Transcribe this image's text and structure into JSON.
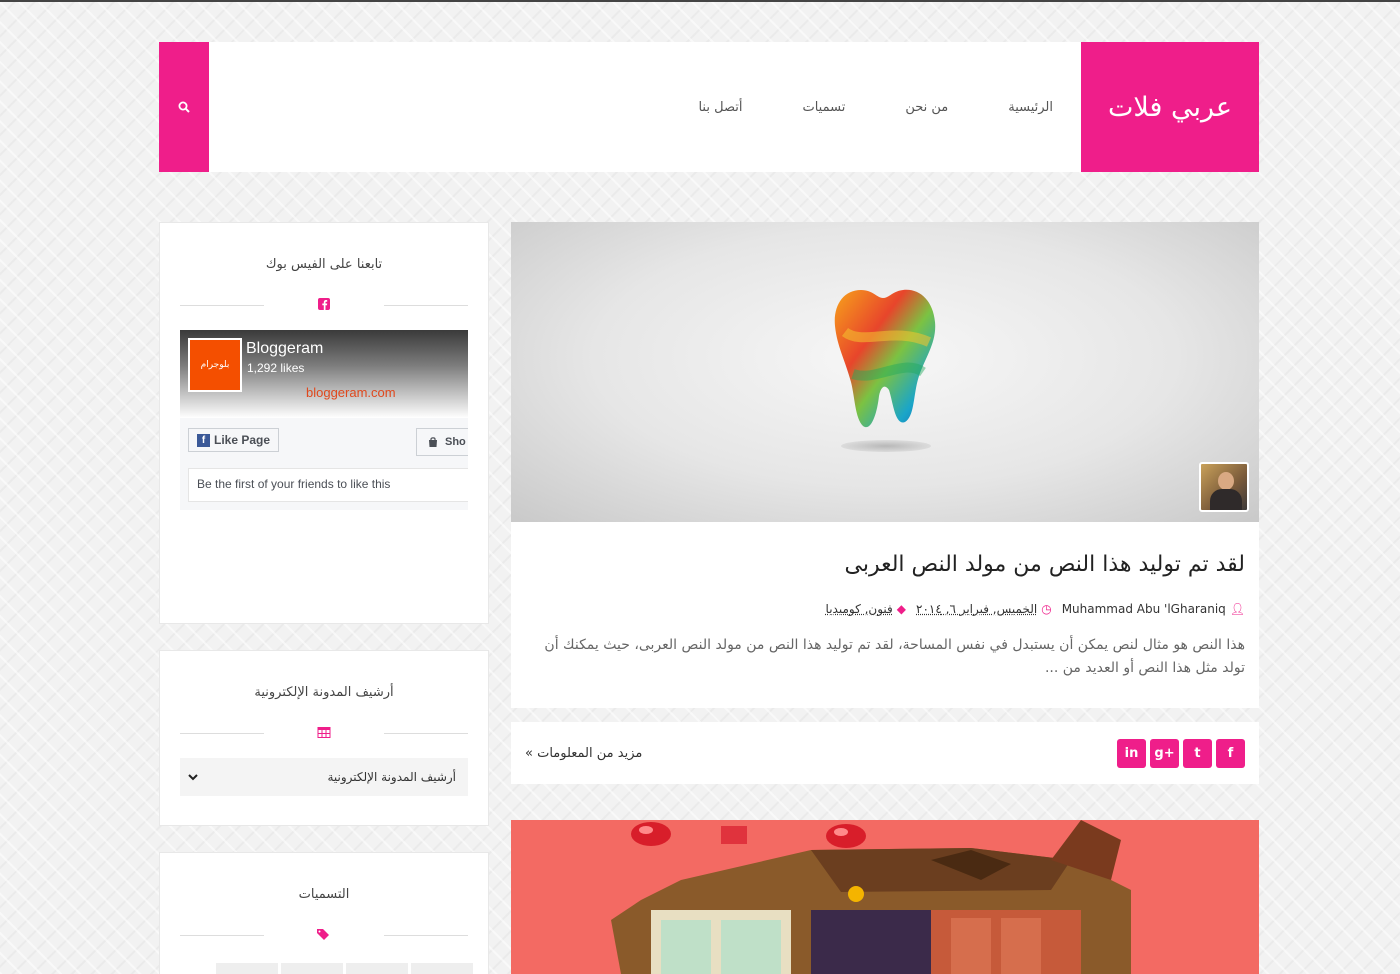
{
  "header": {
    "brand": "عربي فلات",
    "nav": [
      "الرئيسية",
      "من نحن",
      "تسميات",
      "أتصل بنا"
    ],
    "search_icon": "search-icon"
  },
  "post": {
    "title": "لقد تم توليد هذا النص من مولد النص العربى",
    "author": "Muhammad Abu 'lGharaniq",
    "date": "الخميس, فبراير ٦, ٢٠١٤",
    "labels": "فنون, كوميديا",
    "excerpt": "هذا النص هو مثال لنص يمكن أن يستبدل في نفس المساحة، لقد تم توليد هذا النص من مولد النص العربى، حيث يمكنك أن تولد مثل هذا النص أو العديد من ...",
    "more_link": "مزيد من المعلومات »",
    "social": [
      "f",
      "t",
      "g+",
      "in"
    ]
  },
  "sidebar": {
    "facebook": {
      "title": "تابعنا على الفيس بوك",
      "page_name": "Bloggeram",
      "logo_text": "بلوجرام",
      "likes": "1,292 likes",
      "url": "bloggeram.com",
      "like_button": "Like Page",
      "shop_button": "Sho",
      "friends_text": "Be the first of your friends to like this"
    },
    "archive": {
      "title": "أرشيف المدونة الإلكترونية",
      "select_value": "أرشيف المدونة الإلكترونية"
    },
    "labels": {
      "title": "التسميات"
    }
  },
  "colors": {
    "accent": "#ef1e8a",
    "post2_background": "#f36a63"
  }
}
